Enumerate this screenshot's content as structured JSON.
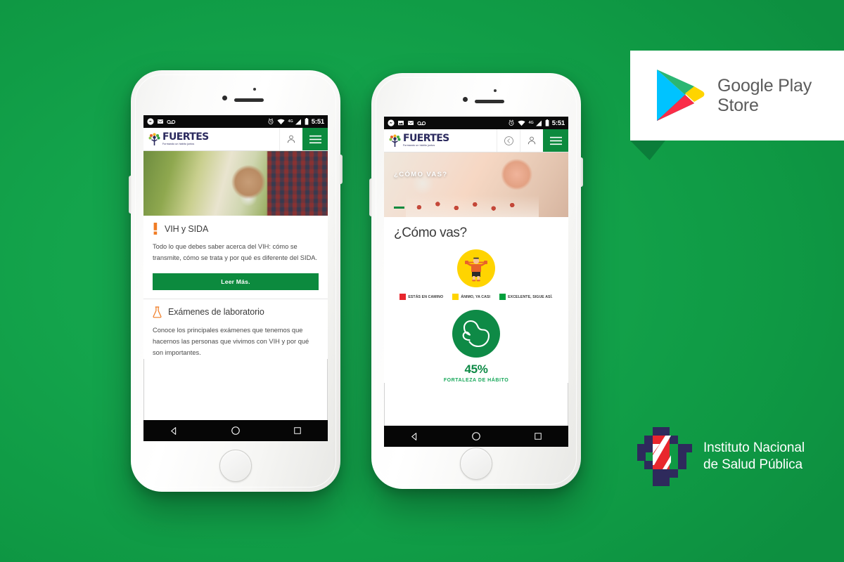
{
  "background": {
    "color": "#11a04a"
  },
  "brand": {
    "name": "FUERTES",
    "tagline": "Formando un hábito juntos",
    "logo_icon": "tree-people-icon",
    "navy": "#2b2a5e",
    "green": "#0c8a3e"
  },
  "phone1": {
    "status_bar": {
      "icons_left": [
        "messenger-icon",
        "gmail-icon",
        "voicemail-icon"
      ],
      "icons_right": [
        "alarm-icon",
        "wifi-icon",
        "signal-icon",
        "battery-icon"
      ],
      "network_label": "4G",
      "time": "5:51"
    },
    "appbar": {
      "user_icon": "user-account-icon",
      "menu_icon": "hamburger-menu-icon"
    },
    "hero": {
      "image_alt": "smiling-man-with-coffee-photo"
    },
    "cards": [
      {
        "icon": "exclamation-mark-icon",
        "icon_color": "#f07c25",
        "title": "VIH y SIDA",
        "body": "Todo lo que debes saber acerca del VIH: cómo se transmite, cómo se trata y por qué es diferente del SIDA.",
        "cta": "Leer Más."
      },
      {
        "icon": "laboratory-flask-icon",
        "icon_color": "#f07c25",
        "title": "Exámenes de laboratorio",
        "body": "Conoce los principales exámenes que tenemos que hacernos las personas que vivimos con VIH y por qué son importantes."
      }
    ],
    "navbar": {
      "back": "back-triangle-icon",
      "home": "home-circle-icon",
      "recents": "recents-square-icon"
    }
  },
  "phone2": {
    "status_bar": {
      "icons_left": [
        "messenger-icon",
        "photos-icon",
        "gmail-icon",
        "voicemail-icon"
      ],
      "icons_right": [
        "alarm-icon",
        "wifi-icon",
        "signal-icon",
        "battery-icon"
      ],
      "network_label": "4G",
      "time": "5:51"
    },
    "appbar": {
      "back_icon": "back-circle-icon",
      "user_icon": "user-account-icon",
      "menu_icon": "hamburger-menu-icon"
    },
    "hero": {
      "image_alt": "hand-holding-pills-photo",
      "overlay_title": "¿CÓMO VAS?"
    },
    "page_title": "¿Cómo vas?",
    "mood": {
      "icon": "weightlifter-person-icon",
      "circle_color": "#ffd400"
    },
    "legend": [
      {
        "color": "#e8262d",
        "label": "ESTÁS EN CAMINO"
      },
      {
        "color": "#ffd400",
        "label": "ÁNIMO, YA CASI"
      },
      {
        "color": "#00a03c",
        "label": "EXCELENTE, SIGUE ASÍ."
      }
    ],
    "strength": {
      "icon": "flexed-bicep-icon",
      "percent": "45%",
      "label": "FORTALEZA DE HÁBITO",
      "circle_color": "#0e8a46"
    },
    "navbar": {
      "back": "back-triangle-icon",
      "home": "home-circle-icon",
      "recents": "recents-square-icon"
    }
  },
  "google_play_badge": {
    "icon": "google-play-triangle-icon",
    "line1": "Google Play",
    "line2": "Store"
  },
  "insp_logo": {
    "icon": "insp-pixel-cross-icon",
    "line1": "Instituto Nacional",
    "line2": "de Salud Pública"
  }
}
